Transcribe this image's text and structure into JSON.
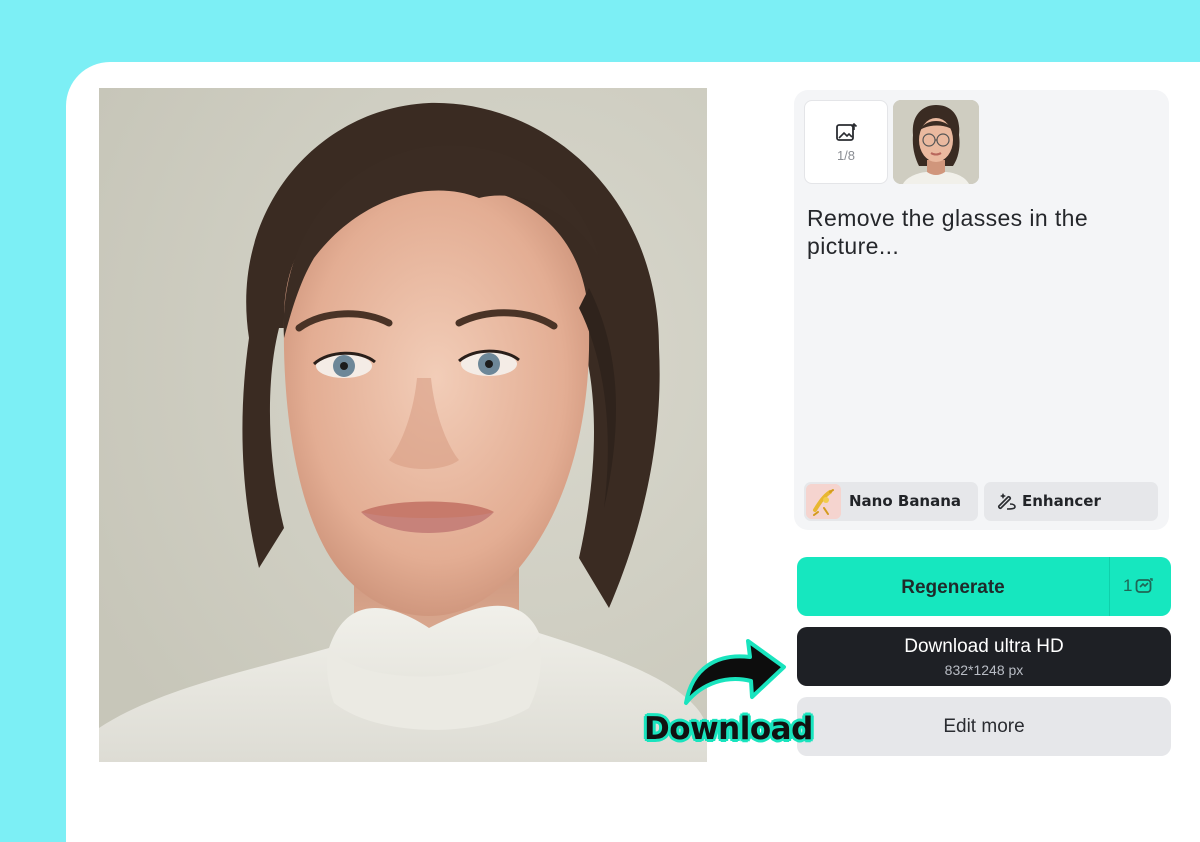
{
  "upload": {
    "icon": "image-upload-icon",
    "count": "1/8"
  },
  "prompt": {
    "text": "Remove the glasses in the picture..."
  },
  "options": {
    "model_label": "Nano Banana",
    "model_icon": "banana-model-icon",
    "enhancer_label": "Enhancer",
    "enhancer_icon": "magic-wand-icon"
  },
  "actions": {
    "regenerate_label": "Regenerate",
    "regenerate_credit": "1",
    "regenerate_credit_icon": "credit-icon",
    "download_label": "Download ultra HD",
    "download_resolution": "832*1248 px",
    "edit_label": "Edit more"
  },
  "callout": {
    "text": "Download",
    "icon": "curved-arrow-icon"
  },
  "colors": {
    "background": "#7ceff5",
    "accent": "#16e7bf",
    "dark_button": "#1e2025"
  }
}
